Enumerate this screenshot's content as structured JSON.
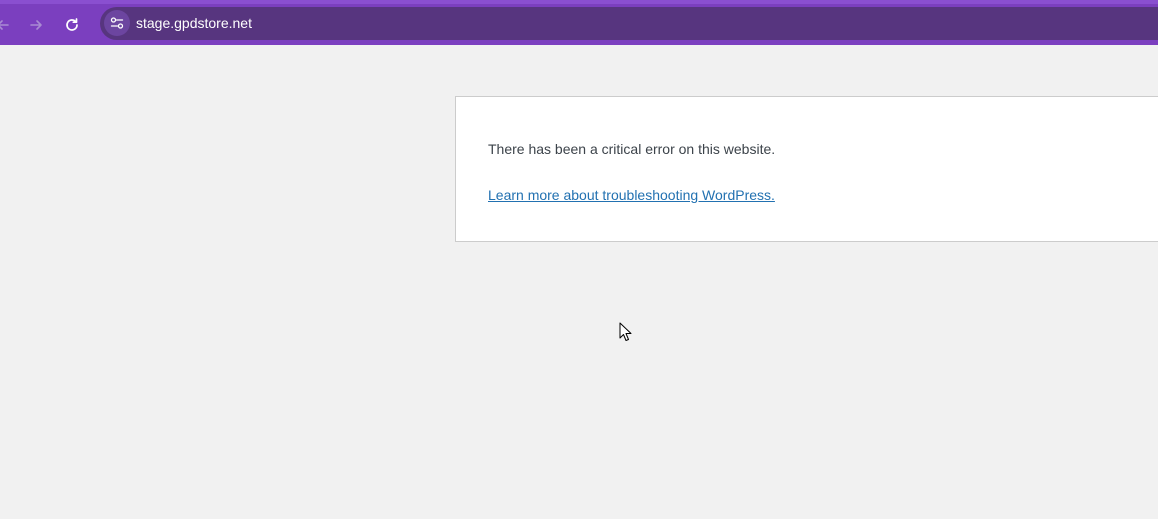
{
  "browser": {
    "url": "stage.gpdstore.net",
    "colors": {
      "toolbar": "#7b3fbf",
      "omnibox": "#57357f"
    },
    "icons": [
      "back-arrow-icon",
      "forward-arrow-icon",
      "reload-icon",
      "site-settings-icon"
    ]
  },
  "page": {
    "error_message": "There has been a critical error on this website.",
    "help_link_text": "Learn more about troubleshooting WordPress.",
    "colors": {
      "background": "#f1f1f1",
      "link": "#2271b1",
      "text": "#3c434a"
    }
  }
}
